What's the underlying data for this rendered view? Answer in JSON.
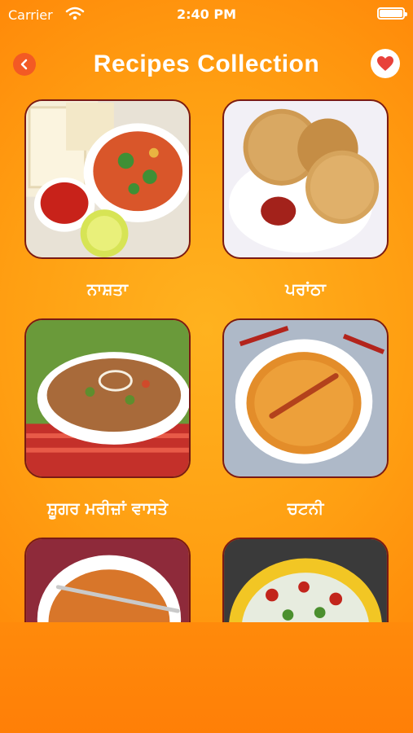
{
  "status": {
    "carrier": "Carrier",
    "time": "2:40 PM",
    "battery_level": 0.95
  },
  "nav": {
    "title": "Recipes Collection",
    "back_icon": "chevron-left-icon",
    "favorite_icon": "heart-icon"
  },
  "categories": [
    {
      "label": "ਨਾਸ਼ਤਾ"
    },
    {
      "label": "ਪਰਾਂਠਾ"
    },
    {
      "label": "ਸ਼ੂਗਰ ਮਰੀਜ਼ਾਂ ਵਾਸਤੇ"
    },
    {
      "label": "ਚਟਨੀ"
    },
    {
      "label": ""
    },
    {
      "label": ""
    }
  ],
  "colors": {
    "accent": "#f35a24",
    "card_border": "#7a1a14",
    "heart": "#e8413a"
  }
}
